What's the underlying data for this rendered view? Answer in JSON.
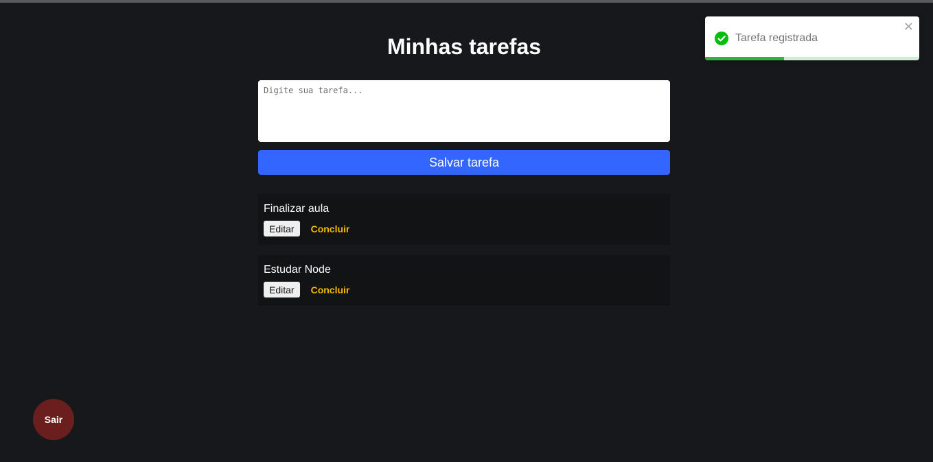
{
  "page": {
    "title": "Minhas tarefas"
  },
  "task_form": {
    "placeholder": "Digite sua tarefa...",
    "value": "",
    "save_label": "Salvar tarefa"
  },
  "tasks": [
    {
      "text": "Finalizar aula",
      "edit_label": "Editar",
      "conclude_label": "Concluir"
    },
    {
      "text": "Estudar Node",
      "edit_label": "Editar",
      "conclude_label": "Concluir"
    }
  ],
  "logout": {
    "label": "Sair"
  },
  "toast": {
    "message": "Tarefa registrada",
    "close_symbol": "×",
    "icon": "check-circle-icon",
    "progress_fraction": 0.37
  },
  "colors": {
    "background": "#17181b",
    "primary": "#3366ff",
    "conclude": "#f5b800",
    "logout": "#6b1e1e",
    "toast_success": "#2fb344"
  }
}
